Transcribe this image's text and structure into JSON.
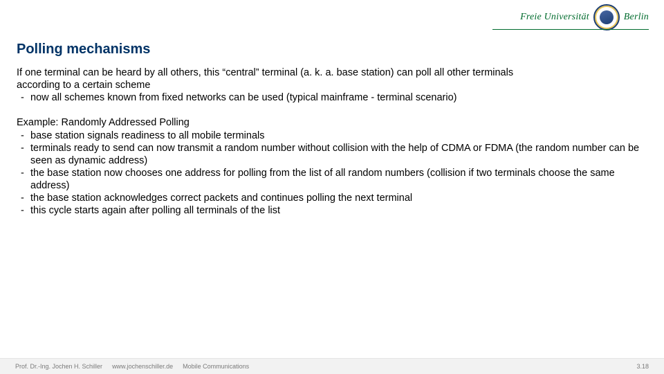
{
  "logo": {
    "text_left": "Freie Universität",
    "text_right": "Berlin"
  },
  "title": "Polling mechanisms",
  "body": {
    "p1_line1": "If one terminal can be heard by all others, this “central” terminal (a. k. a. base station) can poll all other terminals",
    "p1_line2": "according to a certain scheme",
    "p1_bullet1": "now all schemes known from fixed networks can be used (typical mainframe - terminal scenario)",
    "p2_heading": "Example: Randomly Addressed Polling",
    "p2_b1": "base station signals readiness to all mobile terminals",
    "p2_b2": "terminals ready to send can now transmit a random number without collision with the help of CDMA or FDMA (the random number can be seen as dynamic address)",
    "p2_b3": "the base station now chooses one address for polling from the list of all random numbers (collision if two terminals choose the same address)",
    "p2_b4": "the base station acknowledges correct packets and continues polling the next terminal",
    "p2_b5": "this cycle starts again after polling all terminals of the list"
  },
  "footer": {
    "author": "Prof. Dr.-Ing. Jochen H. Schiller",
    "url": "www.jochenschiller.de",
    "course": "Mobile Communications",
    "page": "3.18"
  }
}
